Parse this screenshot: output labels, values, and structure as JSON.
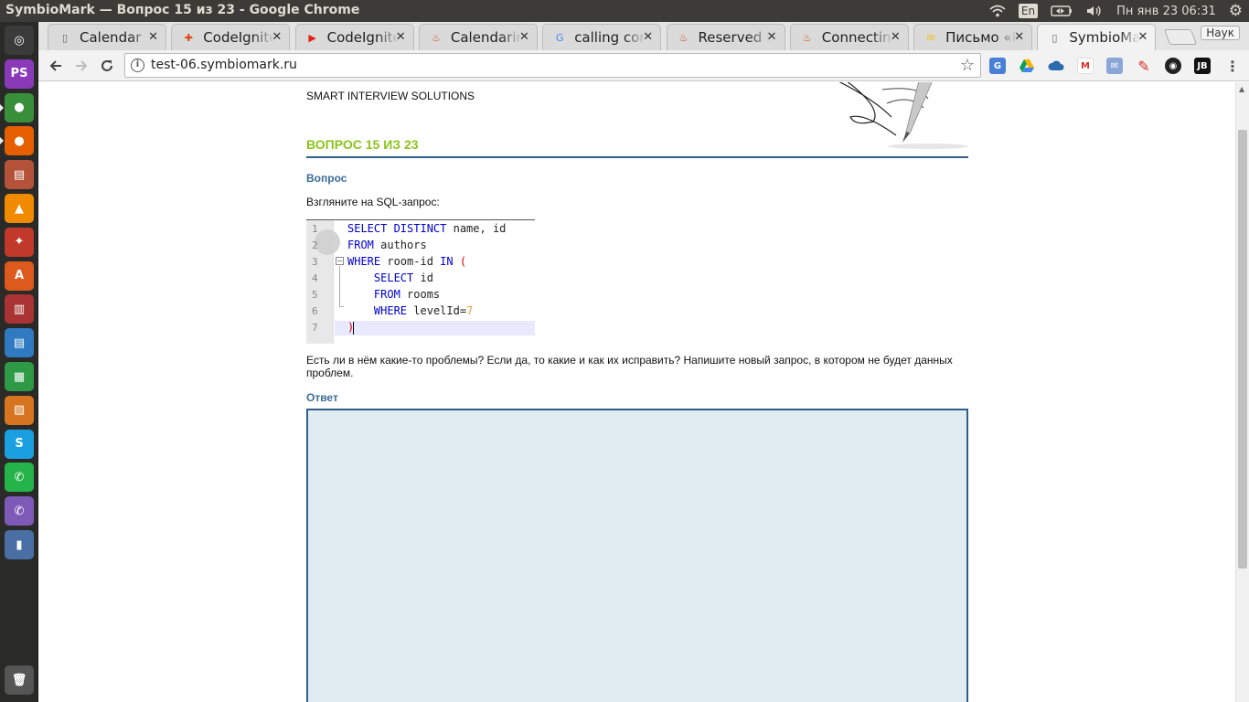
{
  "window_title": "SymbioMark — Вопрос 15 из 23 - Google Chrome",
  "tray": {
    "keyboard_layout": "En",
    "clock": "Пн янв 23 06:31"
  },
  "launcher": {
    "apps": [
      {
        "name": "ubuntu-dash-icon",
        "glyph": "◎",
        "color": "#3b3b3b"
      },
      {
        "name": "phpstorm-icon",
        "glyph": "PS",
        "color": "#8a3ab9"
      },
      {
        "name": "chrome-icon",
        "glyph": "●",
        "color": "#3a8f3a"
      },
      {
        "name": "firefox-icon",
        "glyph": "●",
        "color": "#e66000"
      },
      {
        "name": "files-icon",
        "glyph": "▤",
        "color": "#b4533a"
      },
      {
        "name": "vlc-icon",
        "glyph": "▲",
        "color": "#f08a00"
      },
      {
        "name": "settings-icon",
        "glyph": "✦",
        "color": "#c0392b"
      },
      {
        "name": "software-center-icon",
        "glyph": "A",
        "color": "#dd5a1f"
      },
      {
        "name": "system-monitor-icon",
        "glyph": "▥",
        "color": "#aa3333"
      },
      {
        "name": "writer-icon",
        "glyph": "▤",
        "color": "#2f7ac0"
      },
      {
        "name": "calc-icon",
        "glyph": "▦",
        "color": "#2e9a45"
      },
      {
        "name": "impress-icon",
        "glyph": "▧",
        "color": "#d6741f"
      },
      {
        "name": "skype-icon",
        "glyph": "S",
        "color": "#1a9fe0"
      },
      {
        "name": "whatsapp-icon",
        "glyph": "✆",
        "color": "#25b449"
      },
      {
        "name": "viber-icon",
        "glyph": "✆",
        "color": "#7d5ab8"
      },
      {
        "name": "ruler-icon",
        "glyph": "▮",
        "color": "#4a6fa5"
      }
    ],
    "trash": "trash-icon"
  },
  "tabs": [
    {
      "label": "Calendar",
      "favicon": "page-icon",
      "favicon_color": "#666"
    },
    {
      "label": "CodeIgniter",
      "favicon": "codeigniter-icon",
      "favicon_color": "#dd4814"
    },
    {
      "label": "CodeIgniter",
      "favicon": "youtube-icon",
      "favicon_color": "#e62117"
    },
    {
      "label": "Calendaring",
      "favicon": "flame-icon",
      "favicon_color": "#dd4814"
    },
    {
      "label": "calling con",
      "favicon": "google-icon",
      "favicon_color": "#4285f4"
    },
    {
      "label": "Reserved N",
      "favicon": "flame-icon",
      "favicon_color": "#dd4814"
    },
    {
      "label": "Connecting",
      "favicon": "flame-icon",
      "favicon_color": "#dd4814"
    },
    {
      "label": "Письмо «Н",
      "favicon": "mail-icon",
      "favicon_color": "#f5c518"
    },
    {
      "label": "SymbioMark",
      "favicon": "page-icon",
      "favicon_color": "#666",
      "active": true
    }
  ],
  "profile_label": "Наук",
  "address_bar": {
    "url": "test-06.symbiomark.ru"
  },
  "page": {
    "tagline": "SMART INTERVIEW SOLUTIONS",
    "question_heading": "ВОПРОС 15 ИЗ 23",
    "question_label": "Вопрос",
    "intro": "Взгляните на SQL-запрос:",
    "code_lines": [
      {
        "n": "1",
        "parts": [
          [
            "kw",
            "SELECT DISTINCT"
          ],
          [
            "",
            "name, id"
          ]
        ],
        "sep": " "
      },
      {
        "n": "2",
        "parts": [
          [
            "kw",
            "FROM"
          ],
          [
            "",
            "authors"
          ]
        ],
        "sep": " "
      },
      {
        "n": "3",
        "parts": [
          [
            "kw",
            "WHERE"
          ],
          [
            "",
            "room-id"
          ],
          [
            "kw",
            "IN"
          ],
          [
            "paren",
            "("
          ]
        ],
        "sep": " "
      },
      {
        "n": "4",
        "parts": [
          [
            "",
            "    "
          ],
          [
            "kw",
            "SELECT"
          ],
          [
            "",
            "id"
          ]
        ],
        "sep": " "
      },
      {
        "n": "5",
        "parts": [
          [
            "",
            "    "
          ],
          [
            "kw",
            "FROM"
          ],
          [
            "",
            "rooms"
          ]
        ],
        "sep": " "
      },
      {
        "n": "6",
        "parts": [
          [
            "",
            "    "
          ],
          [
            "kw",
            "WHERE"
          ],
          [
            "",
            "levelId="
          ],
          [
            "num",
            "7"
          ]
        ],
        "sep": " "
      },
      {
        "n": "7",
        "parts": [
          [
            "paren",
            ")"
          ]
        ],
        "sep": ""
      }
    ],
    "problem_line1": "Есть ли в нём какие-то проблемы? Если да, то какие и как их исправить? Напишите новый запрос, в котором не будет данных",
    "problem_line2": "проблем.",
    "answer_label": "Ответ",
    "answer_value": ""
  },
  "colors": {
    "heading_green": "#8ec21b",
    "accent_blue": "#2e5f8a",
    "answer_bg": "#e1ebf2"
  }
}
